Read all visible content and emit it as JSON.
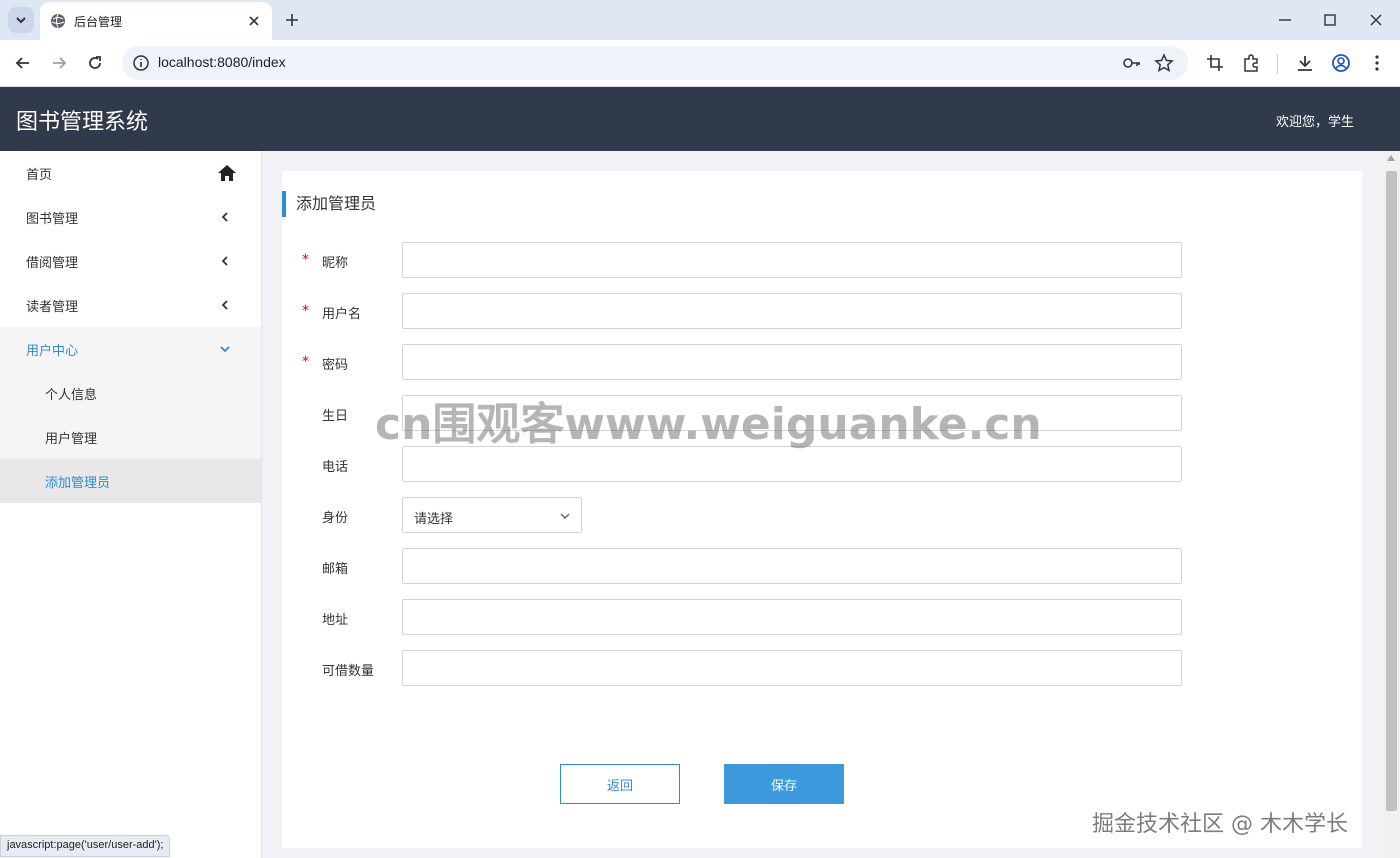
{
  "browser": {
    "tab_title": "后台管理",
    "url": "localhost:8080/index",
    "status_text": "javascript:page('user/user-add');"
  },
  "app": {
    "title": "图书管理系统",
    "welcome": "欢迎您，学生"
  },
  "sidebar": {
    "items": [
      {
        "label": "首页",
        "icon": "home-icon"
      },
      {
        "label": "图书管理",
        "icon": "chevron-left-icon"
      },
      {
        "label": "借阅管理",
        "icon": "chevron-left-icon"
      },
      {
        "label": "读者管理",
        "icon": "chevron-left-icon"
      },
      {
        "label": "用户中心",
        "icon": "chevron-down-icon",
        "expanded": true
      }
    ],
    "submenu": [
      {
        "label": "个人信息"
      },
      {
        "label": "用户管理"
      },
      {
        "label": "添加管理员",
        "selected": true
      }
    ]
  },
  "form": {
    "title": "添加管理员",
    "required_mark": "*",
    "fields": [
      {
        "label": "昵称",
        "required": true,
        "value": ""
      },
      {
        "label": "用户名",
        "required": true,
        "value": ""
      },
      {
        "label": "密码",
        "required": true,
        "value": ""
      },
      {
        "label": "生日",
        "required": false,
        "value": ""
      },
      {
        "label": "电话",
        "required": false,
        "value": ""
      },
      {
        "label": "身份",
        "required": false,
        "type": "select",
        "selected": "请选择"
      },
      {
        "label": "邮箱",
        "required": false,
        "value": ""
      },
      {
        "label": "地址",
        "required": false,
        "value": ""
      },
      {
        "label": "可借数量",
        "required": false,
        "value": ""
      }
    ],
    "back_label": "返回",
    "save_label": "保存"
  },
  "watermarks": {
    "center": "cn围观客www.weiguanke.cn",
    "corner": "掘金技术社区 @ 木木学长"
  },
  "colors": {
    "header_bg": "#303a4a",
    "accent": "#2d8cd4",
    "save_button": "#3c9adc",
    "required": "#d9001b"
  }
}
